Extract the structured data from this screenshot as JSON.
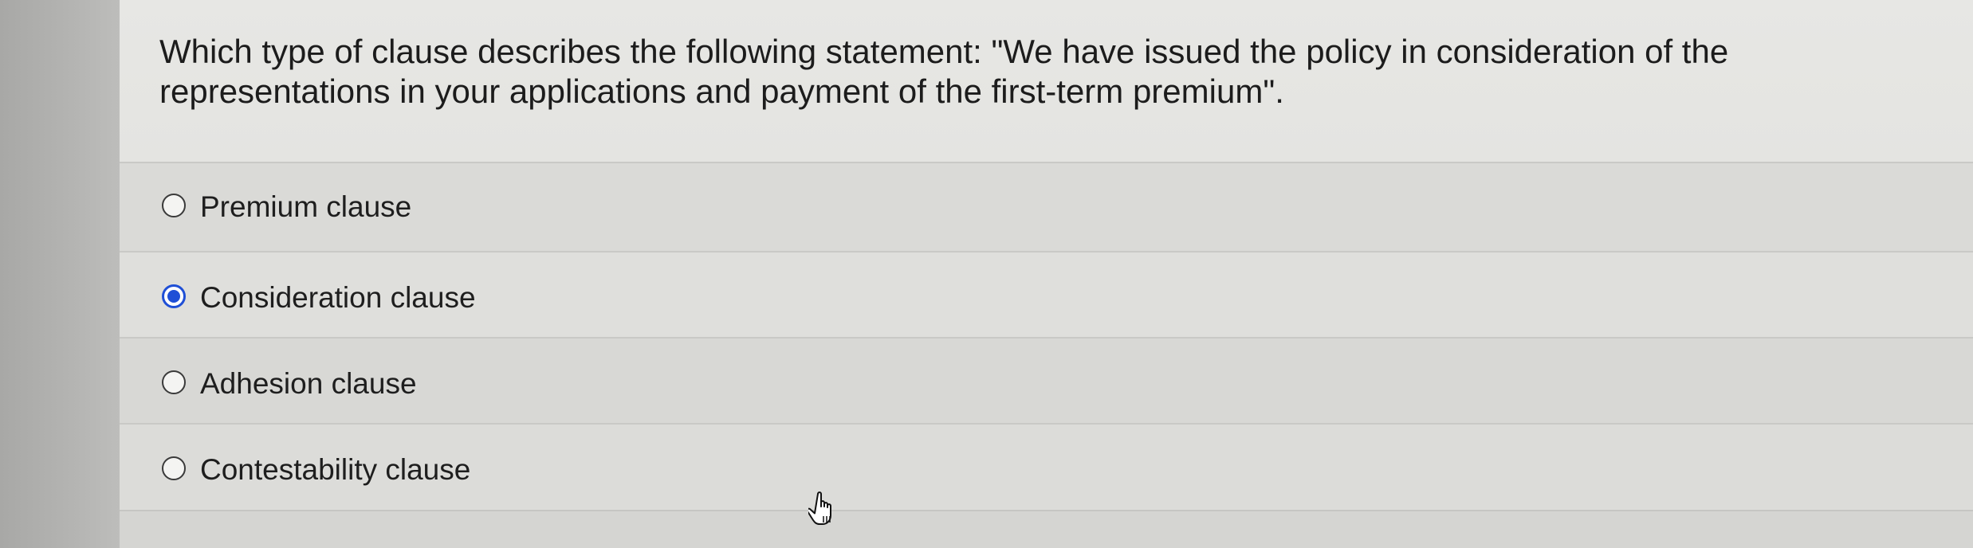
{
  "question": {
    "text": "Which type of clause describes the following statement: \"We have issued the policy in consideration of the representations in your applications and payment of the first-term premium\"."
  },
  "options": [
    {
      "label": "Premium clause",
      "selected": false
    },
    {
      "label": "Consideration clause",
      "selected": true
    },
    {
      "label": "Adhesion clause",
      "selected": false
    },
    {
      "label": "Contestability clause",
      "selected": false
    }
  ],
  "colors": {
    "radio_selected": "#1f4fd6",
    "background": "#e2e2df"
  },
  "icons": {
    "cursor": "hand-pointer-icon"
  }
}
